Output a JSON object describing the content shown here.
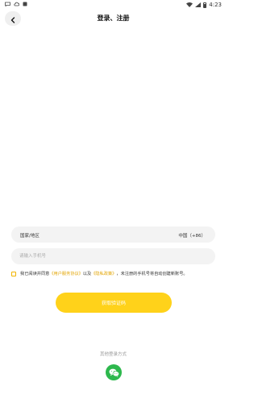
{
  "status_bar": {
    "time": "4:23",
    "icons": [
      "message-icon",
      "cloud-icon",
      "notification-icon",
      "wifi-icon",
      "signal-icon",
      "battery-icon"
    ]
  },
  "header": {
    "title": "登录、注册",
    "back_icon": "chevron-left-icon"
  },
  "form": {
    "region_label": "国家/地区",
    "region_value": "中国（+86）",
    "phone_placeholder": "请输入手机号",
    "phone_value": ""
  },
  "agreement": {
    "prefix": "我已阅读并同意",
    "user_agreement": "《用户服务协议》",
    "and": "以及",
    "privacy_policy": "《隐私政策》",
    "suffix": "，未注册的手机号将自动创建新账号。"
  },
  "cta": {
    "label": "获取验证码"
  },
  "other_login": {
    "label": "其他登录方式",
    "wechat_icon": "wechat-icon"
  },
  "colors": {
    "accent": "#ffd21a",
    "link": "#e2a400",
    "wechat": "#2db84d",
    "field_bg": "#f3f3f3"
  }
}
